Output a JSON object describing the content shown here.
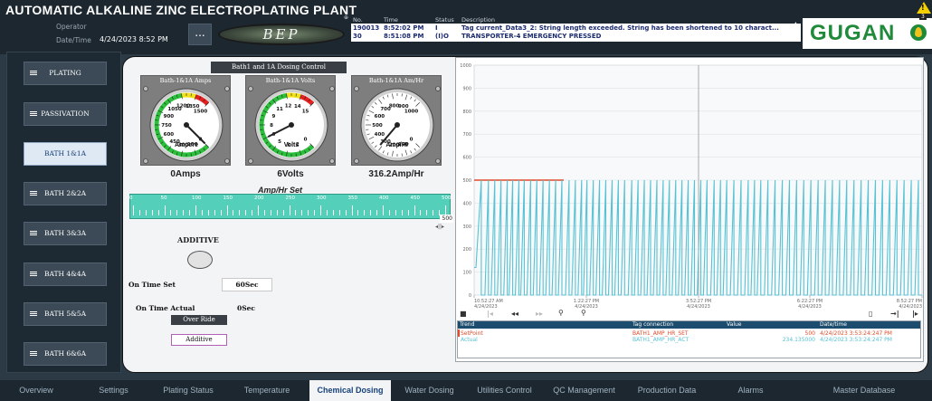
{
  "header": {
    "title": "AUTOMATIC ALKALINE ZINC ELECTROPLATING PLANT",
    "operator_label": "Operator",
    "datetime_label": "Date/Time",
    "datetime_value": "4/24/2023 8:52 PM",
    "more_label": "...",
    "logo_text": "BEP",
    "brand": "GUGAN",
    "alarm_count": "3"
  },
  "alarm_table": {
    "toggle": "⊕",
    "columns": [
      "No.",
      "Time",
      "Status",
      "Description"
    ],
    "rows": [
      {
        "no": "190013",
        "time": "8:52:02 PM",
        "status": "I",
        "description": "Tag current_Data3_2: String length exceeded. String has been shortened to 10 charact..."
      },
      {
        "no": "30",
        "time": "8:51:08 PM",
        "status": "(I)O",
        "description": "TRANSPORTER-4 EMERGENCY PRESSED"
      }
    ]
  },
  "sidebar": {
    "items": [
      {
        "label": "PLATING",
        "icon": "menu-icon",
        "active": false
      },
      {
        "label": "PASSIVATION",
        "icon": "menu-icon",
        "active": false
      },
      {
        "label": "BATH 1&1A",
        "icon": "",
        "active": true
      },
      {
        "label": "BATH 2&2A",
        "icon": "menu-icon",
        "active": false
      },
      {
        "label": "BATH 3&3A",
        "icon": "menu-icon",
        "active": false
      },
      {
        "label": "BATH 4&4A",
        "icon": "menu-icon",
        "active": false
      },
      {
        "label": "BATH 5&5A",
        "icon": "menu-icon",
        "active": false
      },
      {
        "label": "BATH 6&6A",
        "icon": "menu-icon",
        "active": false
      }
    ]
  },
  "dosing": {
    "title": "Bath1 and 1A Dosing Control",
    "gauges": [
      {
        "title": "Bath-1&1A Amps",
        "unit": "Ampere",
        "scale": [
          "0",
          "150",
          "300",
          "450",
          "600",
          "750",
          "900",
          "1050",
          "1200",
          "1350",
          "1500"
        ],
        "max": 1500,
        "value": 0,
        "reading": "0Amps"
      },
      {
        "title": "Bath-1&1A Volts",
        "unit": "Volts",
        "scale": [
          "0",
          "2",
          "3",
          "5",
          "6",
          "8",
          "9",
          "11",
          "12",
          "14",
          "15"
        ],
        "max": 15,
        "value": 6,
        "reading": "6Volts"
      },
      {
        "title": "Bath-1&1A Am/Hr",
        "unit": "Amp/Hr",
        "scale": [
          "0",
          "100",
          "200",
          "300",
          "400",
          "500",
          "600",
          "700",
          "800",
          "900",
          "1000"
        ],
        "max": 1000,
        "value": 316.2,
        "reading": "316.2Amp/Hr"
      }
    ],
    "slider": {
      "title": "Amp/Hr Set",
      "ticks": [
        "0",
        "50",
        "100",
        "150",
        "200",
        "250",
        "300",
        "350",
        "400",
        "450",
        "500"
      ],
      "value": "500",
      "step_control": "◂||▸"
    },
    "additive_label": "ADDITIVE",
    "on_time_set_label": "On Time Set",
    "on_time_set_value": "60Sec",
    "on_time_actual_label": "On Time Actual",
    "on_time_actual_value": "0Sec",
    "override_label": "Over Ride",
    "additive_button": "Additive"
  },
  "chart_data": {
    "type": "line",
    "y_ticks": [
      "0",
      "100",
      "200",
      "300",
      "400",
      "500",
      "600",
      "700",
      "800",
      "900",
      "1000"
    ],
    "ylim": [
      0,
      1000
    ],
    "x_ticks": [
      {
        "time": "10:52:27 AM",
        "date": "4/24/2023"
      },
      {
        "time": "1:22:27 PM",
        "date": "4/24/2023"
      },
      {
        "time": "3:52:27 PM",
        "date": "4/24/2023"
      },
      {
        "time": "6:22:27 PM",
        "date": "4/24/2023"
      },
      {
        "time": "8:52:27 PM",
        "date": "4/24/2023"
      }
    ],
    "series": [
      {
        "name": "SetPoint",
        "color": "#e14b2a",
        "points": [
          [
            0,
            500
          ],
          [
            1,
            500
          ]
        ]
      },
      {
        "name": "Actual",
        "color": "#58c2d4",
        "points": [
          [
            0,
            120
          ],
          [
            0.02,
            120
          ],
          [
            0.08,
            500
          ],
          [
            0.08,
            0
          ],
          [
            0.12,
            0
          ],
          [
            0.16,
            500
          ],
          [
            0.16,
            0
          ],
          [
            0.19,
            0
          ],
          [
            0.23,
            500
          ],
          [
            0.23,
            0
          ],
          [
            0.26,
            0
          ],
          [
            0.3,
            500
          ],
          [
            0.3,
            0
          ],
          [
            0.33,
            0
          ],
          [
            0.37,
            500
          ],
          [
            0.37,
            0
          ],
          [
            0.39,
            0
          ],
          [
            0.43,
            500
          ],
          [
            0.43,
            0
          ],
          [
            0.46,
            0
          ],
          [
            0.5,
            500
          ],
          [
            0.5,
            0
          ],
          [
            0.52,
            0
          ],
          [
            0.56,
            500
          ],
          [
            0.56,
            0
          ],
          [
            0.59,
            0
          ],
          [
            0.63,
            500
          ],
          [
            0.63,
            0
          ],
          [
            0.66,
            0
          ],
          [
            0.7,
            500
          ],
          [
            0.7,
            0
          ],
          [
            0.73,
            0
          ],
          [
            0.77,
            500
          ],
          [
            0.77,
            0
          ],
          [
            0.8,
            0
          ],
          [
            0.84,
            500
          ],
          [
            0.84,
            0
          ],
          [
            0.87,
            0
          ],
          [
            0.91,
            500
          ],
          [
            0.91,
            0
          ],
          [
            0.94,
            0
          ],
          [
            0.98,
            500
          ],
          [
            0.98,
            0
          ],
          [
            1.02,
            0
          ],
          [
            1.06,
            500
          ],
          [
            1.06,
            0
          ],
          [
            1.09,
            0
          ],
          [
            1.13,
            500
          ],
          [
            1.13,
            0
          ],
          [
            1.16,
            0
          ],
          [
            1.2,
            500
          ],
          [
            1.2,
            0
          ],
          [
            1.22,
            0
          ],
          [
            1.26,
            500
          ],
          [
            1.26,
            0
          ],
          [
            1.29,
            0
          ],
          [
            1.33,
            500
          ],
          [
            1.33,
            0
          ],
          [
            1.36,
            0
          ],
          [
            1.4,
            500
          ],
          [
            1.4,
            0
          ],
          [
            1.43,
            0
          ],
          [
            1.47,
            500
          ],
          [
            1.47,
            0
          ],
          [
            1.5,
            0
          ],
          [
            1.54,
            500
          ],
          [
            1.54,
            0
          ],
          [
            1.57,
            0
          ],
          [
            1.61,
            500
          ],
          [
            1.61,
            0
          ],
          [
            1.64,
            0
          ],
          [
            1.68,
            500
          ],
          [
            1.68,
            0
          ],
          [
            1.72,
            0
          ],
          [
            1.76,
            500
          ],
          [
            1.76,
            0
          ],
          [
            1.79,
            0
          ],
          [
            1.83,
            500
          ],
          [
            1.83,
            0
          ],
          [
            1.86,
            0
          ],
          [
            1.9,
            500
          ],
          [
            1.9,
            0
          ],
          [
            1.93,
            0
          ],
          [
            1.97,
            500
          ],
          [
            1.97,
            0
          ],
          [
            2.0,
            0
          ],
          [
            2.04,
            500
          ],
          [
            2.04,
            0
          ],
          [
            2.07,
            0
          ],
          [
            2.11,
            500
          ],
          [
            2.11,
            0
          ],
          [
            2.14,
            0
          ],
          [
            2.18,
            500
          ],
          [
            2.18,
            0
          ],
          [
            2.21,
            0
          ],
          [
            2.25,
            500
          ],
          [
            2.25,
            0
          ],
          [
            2.28,
            0
          ],
          [
            2.32,
            500
          ],
          [
            2.32,
            0
          ],
          [
            2.35,
            0
          ],
          [
            2.39,
            500
          ],
          [
            2.39,
            0
          ],
          [
            2.42,
            0
          ],
          [
            2.46,
            500
          ],
          [
            2.46,
            0
          ],
          [
            2.49,
            0
          ],
          [
            2.53,
            500
          ],
          [
            2.53,
            0
          ],
          [
            2.56,
            0
          ],
          [
            2.6,
            500
          ],
          [
            2.6,
            0
          ],
          [
            2.64,
            0
          ],
          [
            2.68,
            500
          ],
          [
            2.68,
            0
          ],
          [
            2.71,
            0
          ],
          [
            2.75,
            500
          ],
          [
            2.75,
            0
          ],
          [
            2.78,
            0
          ],
          [
            2.82,
            500
          ],
          [
            2.82,
            0
          ],
          [
            2.86,
            0
          ],
          [
            2.9,
            500
          ],
          [
            2.9,
            0
          ],
          [
            2.94,
            0
          ],
          [
            2.98,
            500
          ],
          [
            2.98,
            0
          ],
          [
            3.02,
            0
          ],
          [
            3.06,
            500
          ],
          [
            3.06,
            0
          ],
          [
            3.09,
            0
          ],
          [
            3.13,
            500
          ],
          [
            3.13,
            0
          ],
          [
            3.16,
            0
          ],
          [
            3.2,
            500
          ],
          [
            3.2,
            0
          ],
          [
            3.24,
            0
          ],
          [
            3.28,
            500
          ],
          [
            3.28,
            0
          ],
          [
            3.32,
            0
          ],
          [
            3.36,
            500
          ],
          [
            3.36,
            0
          ],
          [
            3.4,
            0
          ],
          [
            3.44,
            500
          ],
          [
            3.44,
            0
          ],
          [
            3.48,
            0
          ],
          [
            3.52,
            500
          ],
          [
            3.52,
            0
          ],
          [
            3.56,
            0
          ],
          [
            3.6,
            500
          ],
          [
            3.6,
            0
          ],
          [
            3.64,
            0
          ],
          [
            3.68,
            500
          ],
          [
            3.68,
            0
          ],
          [
            3.72,
            0
          ],
          [
            3.76,
            500
          ],
          [
            3.76,
            0
          ],
          [
            3.8,
            0
          ],
          [
            3.84,
            500
          ],
          [
            3.84,
            0
          ],
          [
            3.88,
            0
          ],
          [
            3.92,
            500
          ],
          [
            3.92,
            0
          ],
          [
            3.96,
            0
          ],
          [
            4.0,
            500
          ],
          [
            4.0,
            0
          ],
          [
            4.04,
            0
          ],
          [
            4.08,
            500
          ],
          [
            4.08,
            0
          ],
          [
            4.12,
            0
          ],
          [
            4.16,
            500
          ],
          [
            4.16,
            0
          ],
          [
            4.2,
            0
          ],
          [
            4.24,
            500
          ],
          [
            4.24,
            0
          ],
          [
            4.28,
            0
          ],
          [
            4.32,
            500
          ],
          [
            4.32,
            0
          ],
          [
            4.36,
            0
          ],
          [
            4.4,
            500
          ],
          [
            4.4,
            0
          ],
          [
            4.44,
            0
          ],
          [
            4.48,
            500
          ],
          [
            4.48,
            0
          ],
          [
            4.52,
            0
          ],
          [
            4.56,
            500
          ],
          [
            4.56,
            0
          ],
          [
            4.6,
            0
          ],
          [
            4.64,
            500
          ],
          [
            4.64,
            0
          ],
          [
            4.68,
            0
          ],
          [
            4.72,
            500
          ],
          [
            4.72,
            0
          ],
          [
            4.76,
            0
          ],
          [
            4.8,
            500
          ],
          [
            4.8,
            0
          ],
          [
            4.84,
            0
          ],
          [
            4.88,
            500
          ],
          [
            4.88,
            0
          ],
          [
            4.92,
            0
          ],
          [
            4.96,
            500
          ],
          [
            4.96,
            0
          ],
          [
            5.0,
            0
          ]
        ]
      }
    ],
    "legend_table": {
      "columns": [
        "Trend",
        "Tag connection",
        "Value",
        "Date/time"
      ],
      "rows": [
        {
          "trend": "SetPoint",
          "tag": "BATH1_AMP_HR_SET",
          "value": "500",
          "datetime": "4/24/2023 3:53:24:247 PM"
        },
        {
          "trend": "Actual",
          "tag": "BATH1_AMP_HR_ACT",
          "value": "234.135000",
          "datetime": "4/24/2023 3:53:24:247 PM"
        }
      ]
    }
  },
  "tabs": [
    {
      "label": "Overview",
      "active": false
    },
    {
      "label": "Settings",
      "active": false
    },
    {
      "label": "Plating Status",
      "active": false
    },
    {
      "label": "Temperature",
      "active": false
    },
    {
      "label": "Chemical Dosing",
      "active": true
    },
    {
      "label": "Water Dosing",
      "active": false
    },
    {
      "label": "Utilities Control",
      "active": false
    },
    {
      "label": "QC Management",
      "active": false
    },
    {
      "label": "Production Data",
      "active": false
    },
    {
      "label": "Alarms",
      "active": false
    },
    {
      "label": "Master Database",
      "active": false
    }
  ]
}
